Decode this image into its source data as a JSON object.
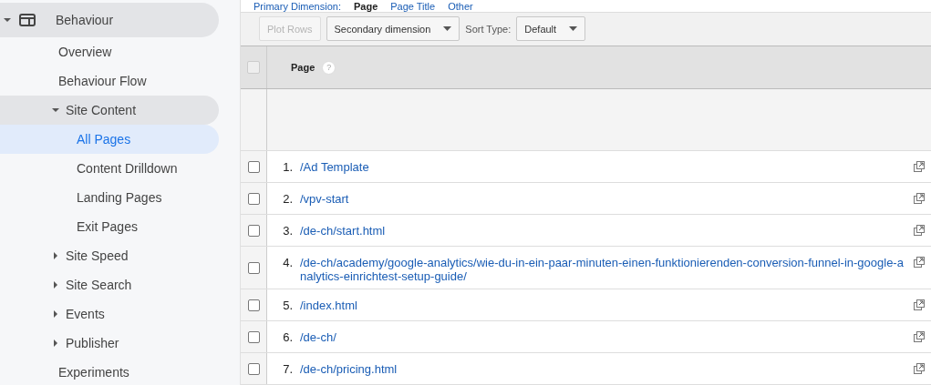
{
  "sidebar": {
    "items": [
      {
        "label": "Behaviour",
        "expanded": true,
        "selected": false,
        "children": [
          {
            "label": "Overview",
            "selected": false
          },
          {
            "label": "Behaviour Flow",
            "selected": false
          },
          {
            "label": "Site Content",
            "expanded": true,
            "selected": false,
            "children": [
              {
                "label": "All Pages",
                "selected": true
              },
              {
                "label": "Content Drilldown",
                "selected": false
              },
              {
                "label": "Landing Pages",
                "selected": false
              },
              {
                "label": "Exit Pages",
                "selected": false
              }
            ]
          },
          {
            "label": "Site Speed",
            "expanded": false,
            "selected": false
          },
          {
            "label": "Site Search",
            "expanded": false,
            "selected": false
          },
          {
            "label": "Events",
            "expanded": false,
            "selected": false
          },
          {
            "label": "Publisher",
            "expanded": false,
            "selected": false
          },
          {
            "label": "Experiments",
            "selected": false
          }
        ]
      }
    ]
  },
  "primary_dimension": {
    "label": "Primary Dimension:",
    "options": [
      {
        "label": "Page",
        "selected": true
      },
      {
        "label": "Page Title",
        "selected": false
      },
      {
        "label": "Other",
        "selected": false
      }
    ]
  },
  "toolbar": {
    "plot_rows": {
      "label": "Plot Rows",
      "disabled": true
    },
    "secondary_dimension": "Secondary dimension",
    "sort_type_label": "Sort Type:",
    "sort_type": "Default"
  },
  "table": {
    "header": {
      "checked": false,
      "column": "Page",
      "help": "?"
    },
    "rows": [
      {
        "index": "1.",
        "page": "/Ad Template",
        "checked": false
      },
      {
        "index": "2.",
        "page": "/vpv-start",
        "checked": false
      },
      {
        "index": "3.",
        "page": "/de-ch/start.html",
        "checked": false
      },
      {
        "index": "4.",
        "page": "/de-ch/academy/google-analytics/wie-du-in-ein-paar-minuten-einen-funktionierenden-conversion-funnel-in-google-analytics-einrichtest-setup-guide/",
        "checked": false
      },
      {
        "index": "5.",
        "page": "/index.html",
        "checked": false
      },
      {
        "index": "6.",
        "page": "/de-ch/",
        "checked": false
      },
      {
        "index": "7.",
        "page": "/de-ch/pricing.html",
        "checked": false
      }
    ]
  }
}
